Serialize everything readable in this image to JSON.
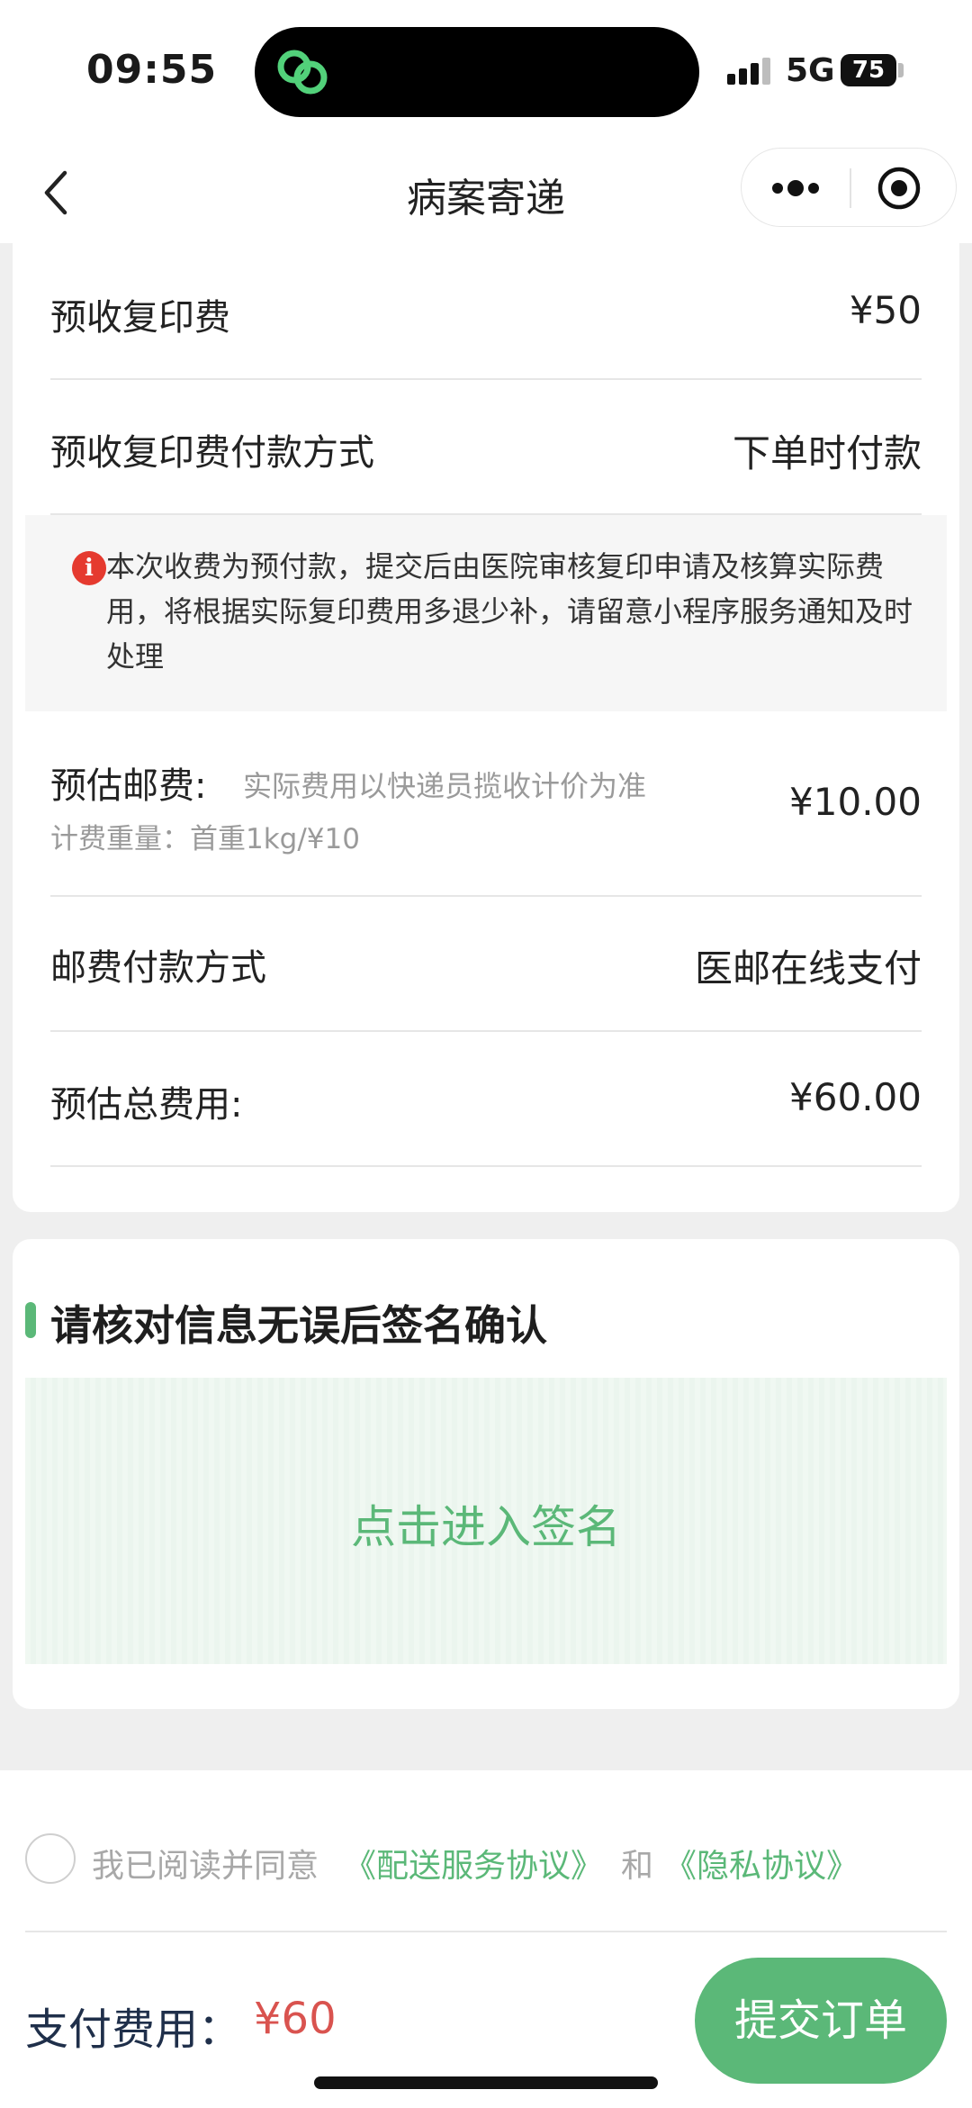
{
  "status_bar": {
    "time": "09:55",
    "network": "5G",
    "battery": "75",
    "island_icon": "green-chain-link-icon"
  },
  "nav": {
    "title": "病案寄递",
    "back_icon": "chevron-left-icon",
    "more_icon": "more-dots-icon",
    "close_icon": "target-circle-icon"
  },
  "fees": {
    "copy_fee_label": "预收复印费",
    "copy_fee_value": "¥50",
    "copy_pay_label": "预收复印费付款方式",
    "copy_pay_value": "下单时付款",
    "notice_text": "本次收费为预付款，提交后由医院审核复印申请及核算实际费用，将根据实际复印费用多退少补，请留意小程序服务通知及时处理",
    "notice_icon_glyph": "i",
    "postage_label": "预估邮费:",
    "postage_note": "实际费用以快递员揽收计价为准",
    "postage_weight": "计费重量：首重1kg/¥10",
    "postage_value": "¥10.00",
    "postage_pay_label": "邮费付款方式",
    "postage_pay_value": "医邮在线支付",
    "total_label": "预估总费用:",
    "total_value": "¥60.00"
  },
  "signature": {
    "section_title": "请核对信息无误后签名确认",
    "sign_prompt": "点击进入签名"
  },
  "agreement": {
    "prefix": "我已阅读并同意",
    "link1": "《配送服务协议》",
    "and": "和",
    "link2": "《隐私协议》"
  },
  "footer": {
    "pay_label": "支付费用：",
    "pay_amount": "¥60",
    "submit_label": "提交订单"
  },
  "colors": {
    "accent_green": "#5bb878",
    "price_red": "#d9534f",
    "notice_red": "#e53a2f"
  }
}
